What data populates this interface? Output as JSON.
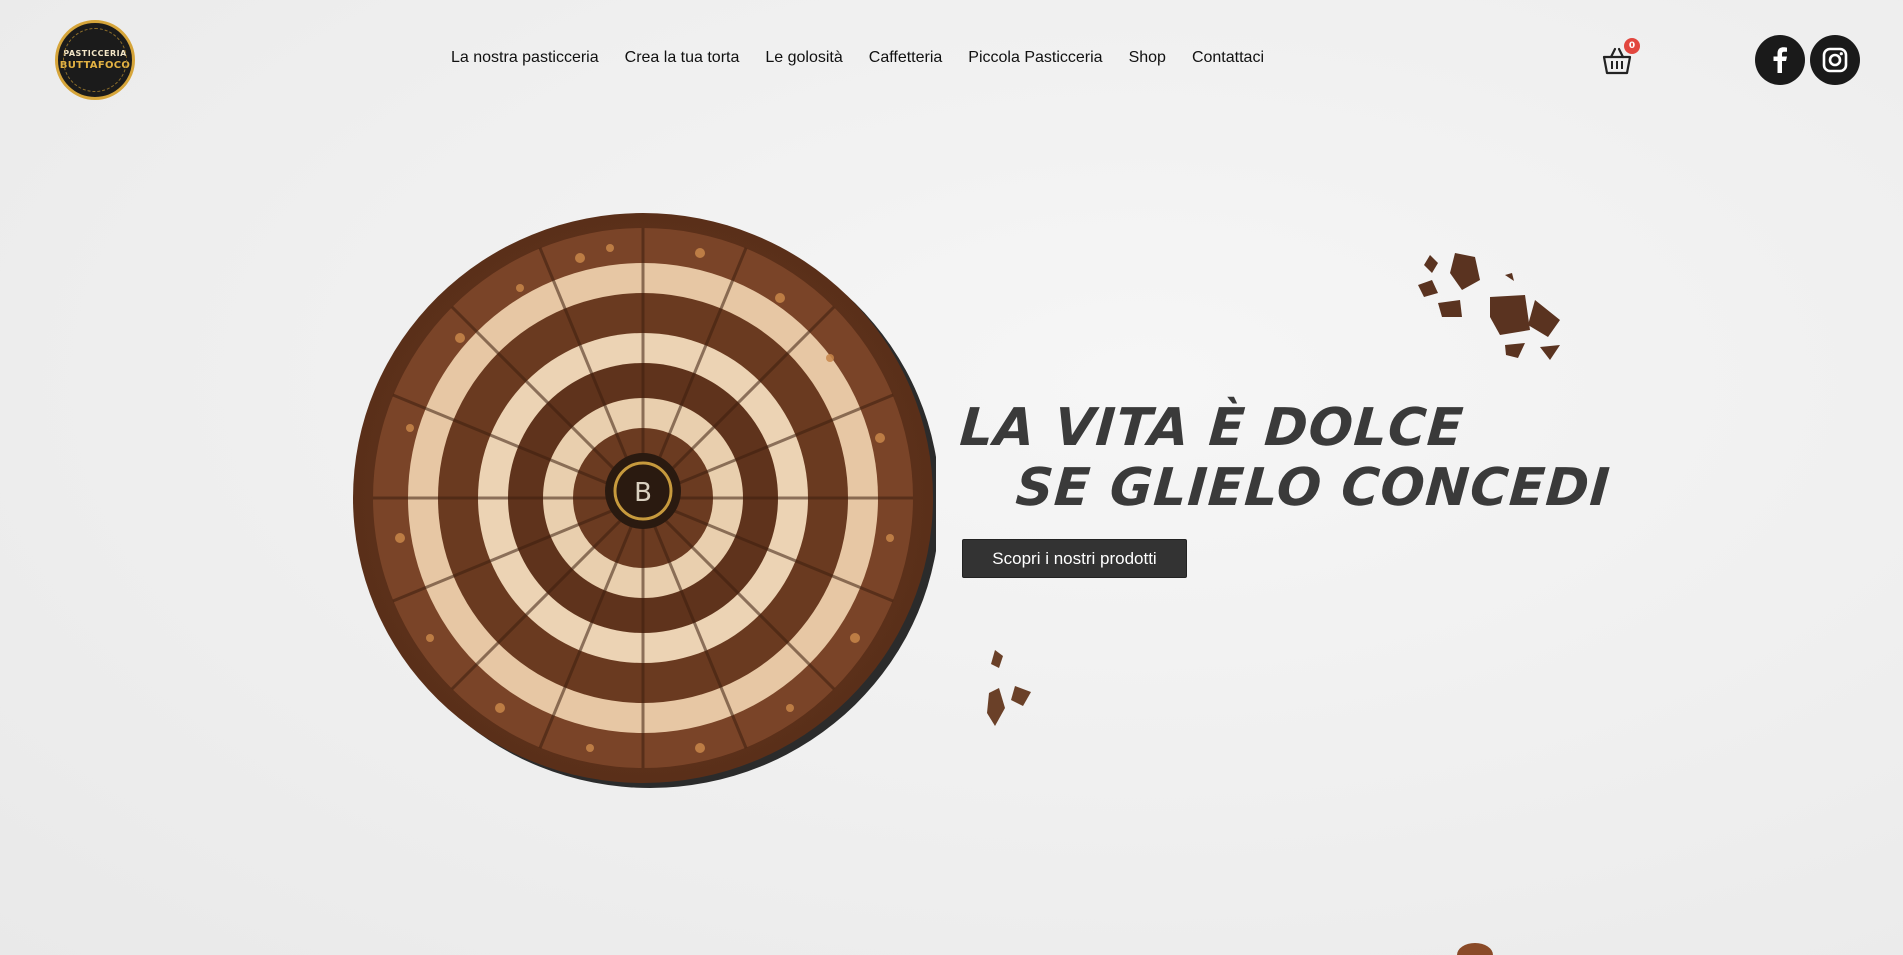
{
  "brand": {
    "line1": "PASTICCERIA",
    "line2": "BUTTAFOCO"
  },
  "nav": [
    {
      "label": "La nostra pasticceria"
    },
    {
      "label": "Crea la tua torta"
    },
    {
      "label": "Le golosità"
    },
    {
      "label": "Caffetteria"
    },
    {
      "label": "Piccola Pasticceria"
    },
    {
      "label": "Shop"
    },
    {
      "label": "Contattaci"
    }
  ],
  "cart": {
    "count": "0",
    "icon": "basket-icon"
  },
  "social": [
    {
      "icon": "facebook-icon"
    },
    {
      "icon": "instagram-icon"
    }
  ],
  "hero": {
    "line1": "LA VITA È DOLCE",
    "line2": "SE GLIELO CONCEDI",
    "cta_label": "Scopri i nostri prodotti",
    "cake_monogram": "B"
  },
  "colors": {
    "accent": "#d6a53a",
    "button": "#333333",
    "badge": "#e2473f",
    "headline": "#3a3a3a"
  }
}
